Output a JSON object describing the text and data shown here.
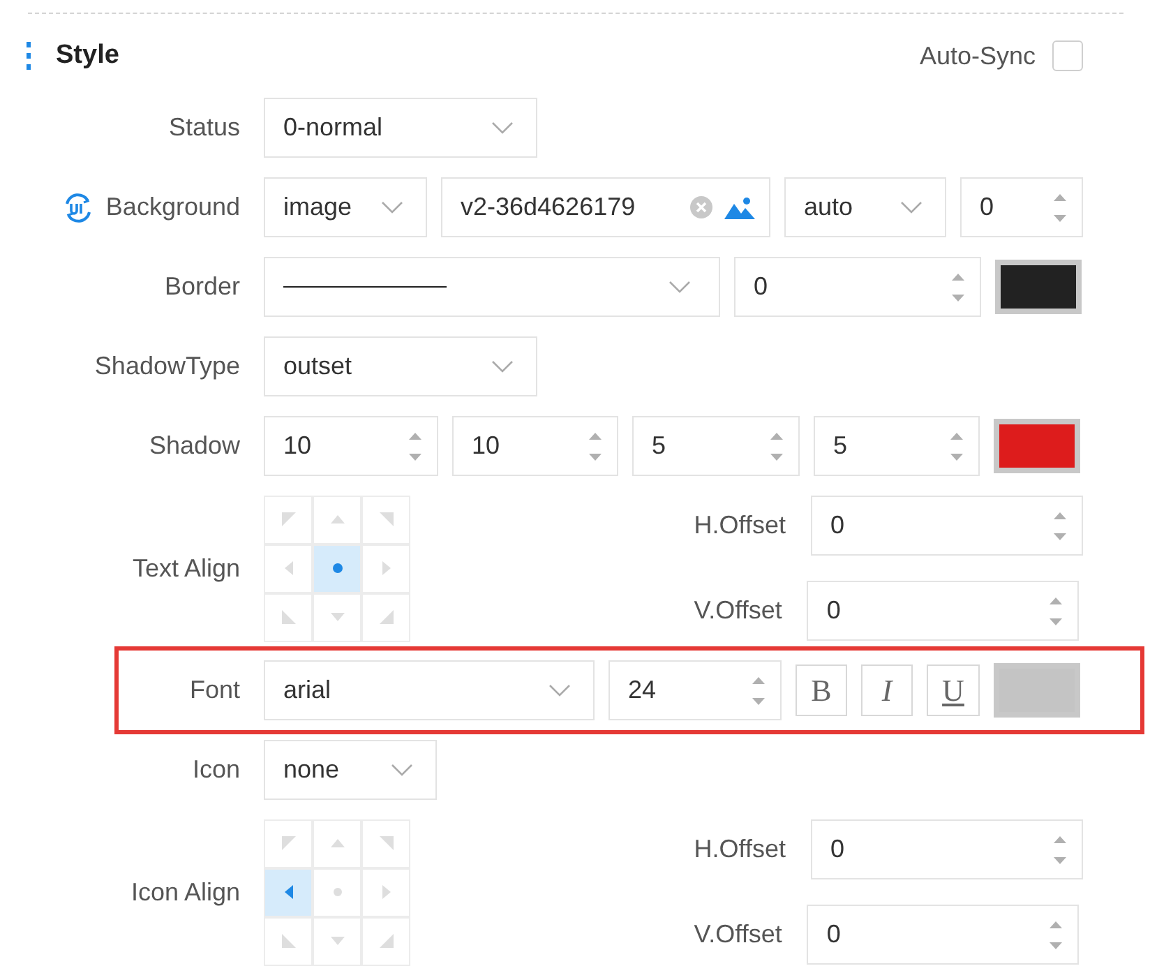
{
  "header": {
    "title": "Style",
    "auto_sync": {
      "label": "Auto-Sync",
      "checked": false
    }
  },
  "rows": [
    {
      "kind": "fields",
      "label": "Status",
      "controls": [
        {
          "kind": "select",
          "value": "0-normal"
        }
      ]
    },
    {
      "kind": "fields",
      "label": "Background",
      "has_icon": true,
      "controls": [
        {
          "kind": "select",
          "value": "image"
        },
        {
          "kind": "file",
          "value": "v2-36d4626179"
        },
        {
          "kind": "select",
          "value": "auto"
        },
        {
          "kind": "number",
          "value": "0"
        }
      ]
    },
    {
      "kind": "fields",
      "label": "Border",
      "controls": [
        {
          "kind": "line"
        },
        {
          "kind": "number",
          "value": "0"
        },
        {
          "kind": "color",
          "color": "#222222"
        }
      ]
    },
    {
      "kind": "fields",
      "label": "ShadowType",
      "controls": [
        {
          "kind": "select",
          "value": "outset"
        }
      ]
    },
    {
      "kind": "fields",
      "label": "Shadow",
      "controls": [
        {
          "kind": "number",
          "value": "10"
        },
        {
          "kind": "number",
          "value": "10"
        },
        {
          "kind": "number",
          "value": "5"
        },
        {
          "kind": "number",
          "value": "5"
        },
        {
          "kind": "color",
          "color": "#dd1c1c"
        }
      ]
    },
    {
      "kind": "align",
      "label": "Text Align",
      "cells": [
        {
          "selected": false
        },
        {
          "selected": false
        },
        {
          "selected": false
        },
        {
          "selected": false
        },
        {
          "selected": true
        },
        {
          "selected": false
        },
        {
          "selected": false
        },
        {
          "selected": false
        },
        {
          "selected": false
        }
      ],
      "offsets": [
        {
          "label": "H.Offset",
          "value": "0"
        },
        {
          "label": "V.Offset",
          "value": "0"
        }
      ]
    },
    {
      "kind": "fields",
      "label": "Font",
      "highlighted": true,
      "controls": [
        {
          "kind": "select",
          "value": "arial"
        },
        {
          "kind": "number",
          "value": "24"
        },
        {
          "kind": "bold",
          "value": "B",
          "on": false
        },
        {
          "kind": "italic",
          "value": "I",
          "on": false
        },
        {
          "kind": "underline",
          "value": "U",
          "on": false
        },
        {
          "kind": "color",
          "color": "#c4c4c4"
        }
      ]
    },
    {
      "kind": "fields",
      "label": "Icon",
      "controls": [
        {
          "kind": "select",
          "value": "none"
        }
      ]
    },
    {
      "kind": "align",
      "label": "Icon Align",
      "cells": [
        {
          "selected": false
        },
        {
          "selected": false
        },
        {
          "selected": false
        },
        {
          "selected": true
        },
        {
          "selected": false
        },
        {
          "selected": false
        },
        {
          "selected": false
        },
        {
          "selected": false
        },
        {
          "selected": false
        }
      ],
      "offsets": [
        {
          "label": "H.Offset",
          "value": "0"
        },
        {
          "label": "V.Offset",
          "value": "0"
        }
      ]
    }
  ]
}
